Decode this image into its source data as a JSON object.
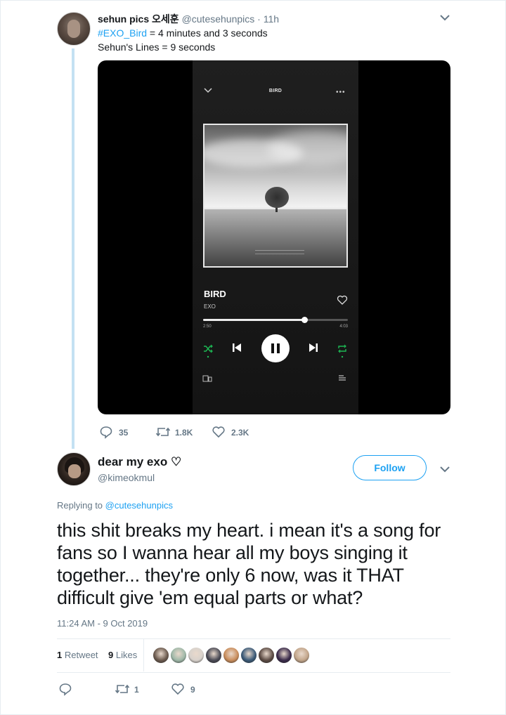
{
  "parent_tweet": {
    "name": "sehun pics 오세훈",
    "handle": "@cutesehunpics",
    "separator_time": "· 11h",
    "line1_hashtag": "#EXO_Bird",
    "line1_rest": " = 4 minutes and 3 seconds",
    "line2": "Sehun's Lines = 9 seconds",
    "media": {
      "header_title": "BIRD",
      "song_title": "BIRD",
      "artist": "EXO",
      "elapsed": "2:50",
      "duration": "4:03",
      "progress": 0.7
    },
    "replies": "35",
    "retweets": "1.8K",
    "likes": "2.3K",
    "icons": [
      "reply-icon",
      "retweet-icon",
      "heart-icon",
      "chevron-down-icon"
    ]
  },
  "main_tweet": {
    "name": "dear my exo ♡",
    "handle": "@kimeokmul",
    "follow_label": "Follow",
    "replying_prefix": "Replying to ",
    "replying_to": "@cutesehunpics",
    "text": "this shit breaks my heart. i mean it's a song for fans so I wanna hear all my boys singing it together... they're only 6 now, was it THAT difficult give 'em equal parts or what?",
    "timestamp": "11:24 AM - 9 Oct 2019",
    "retweet_count": "1",
    "retweet_label": " Retweet",
    "like_count": "9",
    "like_label": " Likes",
    "action_retweets": "1",
    "action_likes": "9"
  },
  "colors": {
    "brand_blue": "#1da1f2",
    "secondary_text": "#657786",
    "thread_line": "#c4e1f3",
    "player_green": "#1db954",
    "liker_avatars": [
      "#6b5a4e",
      "#9fb8a8",
      "#d8d2cc",
      "#4a4a55",
      "#c98d5c",
      "#3b5a78",
      "#5c4b44",
      "#3a2a4a",
      "#c2a58a"
    ]
  }
}
